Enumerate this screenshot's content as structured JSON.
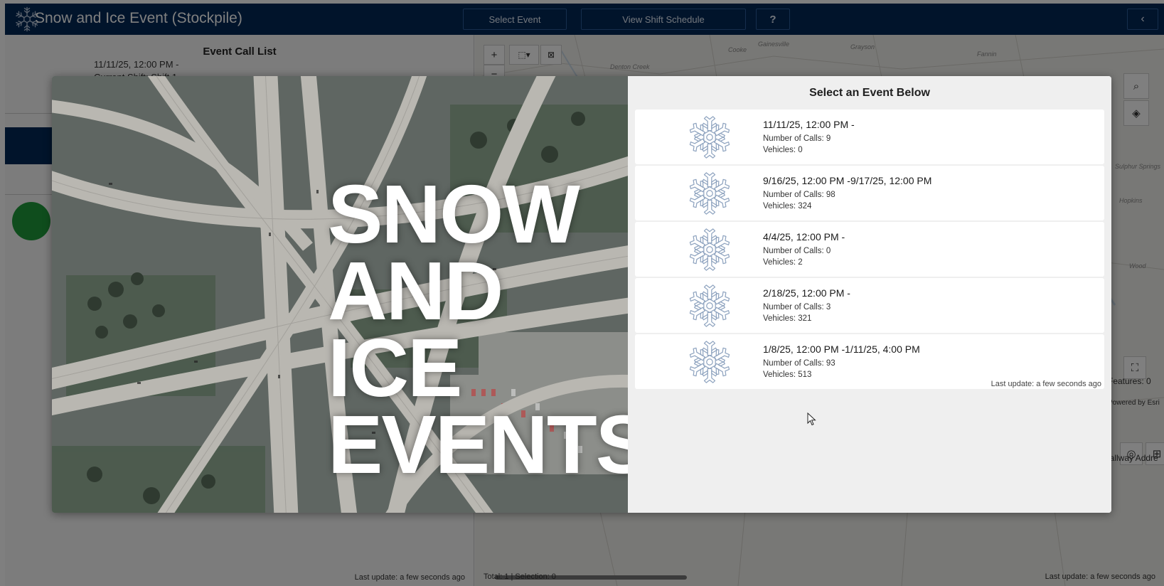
{
  "header": {
    "title": "Snow and Ice Event (Stockpile)",
    "buttons": {
      "select_event": "Select Event",
      "view_shift_schedule": "View Shift Schedule",
      "help": "?",
      "collapse": "‹"
    }
  },
  "left_panel": {
    "list_title": "Event Call List",
    "subtitle_line1": "11/11/25, 12:00 PM -",
    "subtitle_line2": "Current Shift: Shift 1",
    "last_update": "Last update: a few seconds ago"
  },
  "map": {
    "place_labels": [
      "Gainesville",
      "Cooke",
      "Grayson",
      "Fannin",
      "Hopkins",
      "Wood",
      "Denton Creek",
      "Sulphur Springs"
    ],
    "zoom_in": "+",
    "zoom_out": "−",
    "features_text": "Features: 0",
    "powered_by": "Powered by Esri",
    "address_text": "Hallway Addre",
    "total_selection": "Total: 1 | Selection: 0",
    "last_update": "Last update: a few seconds ago"
  },
  "modal": {
    "hero_lines": [
      "SNOW",
      "AND",
      "ICE",
      "EVENTS"
    ],
    "heading": "Select an Event Below",
    "events": [
      {
        "title": "11/11/25, 12:00 PM -",
        "calls": "Number of Calls: 9",
        "vehicles": "Vehicles: 0"
      },
      {
        "title": "9/16/25, 12:00 PM -9/17/25, 12:00 PM",
        "calls": "Number of Calls: 98",
        "vehicles": "Vehicles: 324"
      },
      {
        "title": "4/4/25, 12:00 PM -",
        "calls": "Number of Calls: 0",
        "vehicles": "Vehicles: 2"
      },
      {
        "title": "2/18/25, 12:00 PM -",
        "calls": "Number of Calls: 3",
        "vehicles": "Vehicles: 321"
      },
      {
        "title": "1/8/25, 12:00 PM -1/11/25, 4:00 PM",
        "calls": "Number of Calls: 93",
        "vehicles": "Vehicles: 513"
      }
    ],
    "last_update": "Last update: a few seconds ago"
  },
  "colors": {
    "header_bg": "#032957",
    "status_green": "#1f9a3b",
    "snowflake": "#8ea3bf"
  }
}
